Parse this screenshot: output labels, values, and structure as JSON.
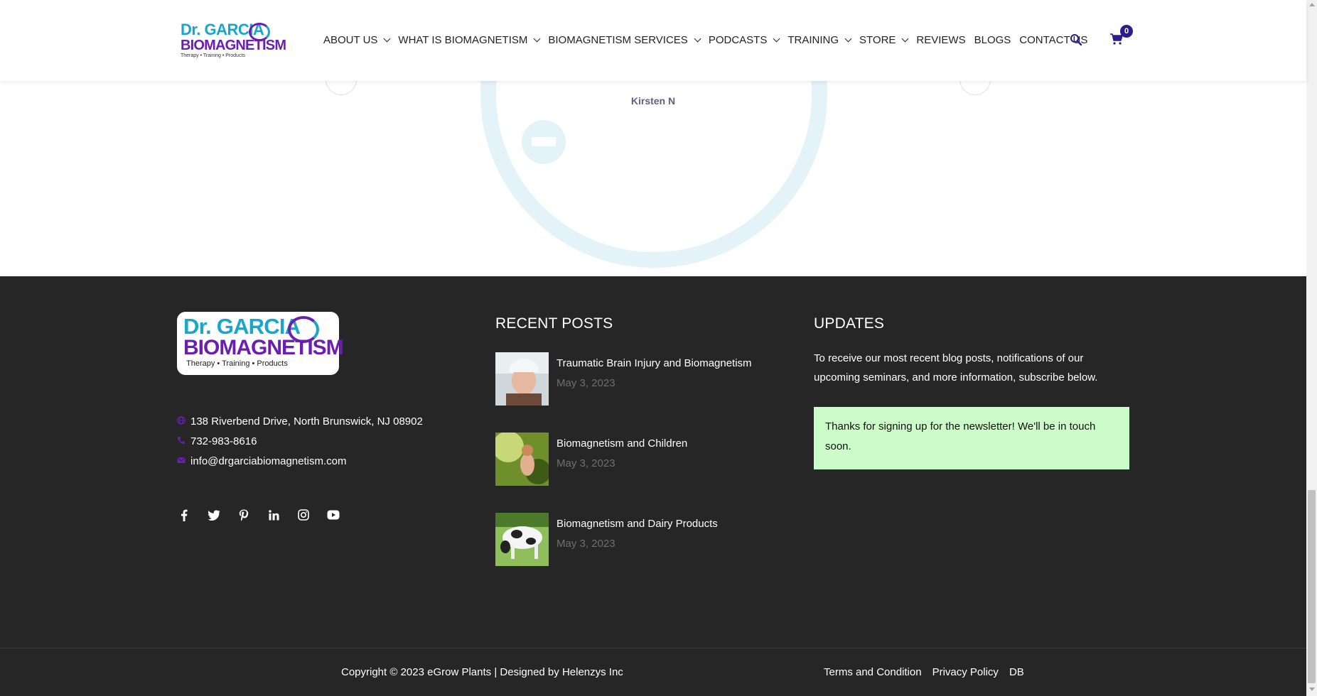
{
  "header": {
    "logo": {
      "line1": "Dr. GARCIA",
      "line2": "BIOMAGNETISM",
      "line3": "Therapy • Training • Products"
    },
    "nav": [
      {
        "label": "ABOUT US",
        "dropdown": true
      },
      {
        "label": "WHAT IS BIOMAGNETISM",
        "dropdown": true
      },
      {
        "label": "BIOMAGNETISM SERVICES",
        "dropdown": true
      },
      {
        "label": "PODCASTS",
        "dropdown": true
      },
      {
        "label": "TRAINING",
        "dropdown": true
      },
      {
        "label": "STORE",
        "dropdown": true
      },
      {
        "label": "REVIEWS",
        "dropdown": false
      },
      {
        "label": "BLOGS",
        "dropdown": false
      },
      {
        "label": "CONTACT US",
        "dropdown": false
      }
    ],
    "cart_count": "0",
    "icons": {
      "search": "search-icon",
      "cart": "cart-icon"
    }
  },
  "testimonial": {
    "reviewer": "Kirsten N"
  },
  "footer": {
    "logo": {
      "line1": "Dr. GARCIA",
      "line2": "BIOMAGNETISM",
      "line3": "Therapy • Training • Products"
    },
    "contact": {
      "address": "138 Riverbend Drive, North Brunswick, NJ 08902",
      "phone": "732-983-8616",
      "email": "info@drgarciabiomagnetism.com"
    },
    "social": [
      "facebook-icon",
      "twitter-icon",
      "pinterest-icon",
      "linkedin-icon",
      "instagram-icon",
      "youtube-icon"
    ],
    "recent_posts": {
      "title": "RECENT POSTS",
      "posts": [
        {
          "title": "Traumatic Brain Injury and Biomagnetism",
          "date": "May 3, 2023"
        },
        {
          "title": "Biomagnetism and Children",
          "date": "May 3, 2023"
        },
        {
          "title": "Biomagnetism and Dairy Products",
          "date": "May 3, 2023"
        }
      ]
    },
    "updates": {
      "title": "UPDATES",
      "text": "To receive our most recent blog posts, notifications of our upcoming seminars, and more information, subscribe below.",
      "success": "Thanks for signing up for the newsletter! We'll be in touch soon."
    }
  },
  "bottom": {
    "copyright": "Copyright © 2023 eGrow Plants | Designed by Helenzys Inc",
    "links": [
      "Terms and Condition",
      "Privacy Policy",
      "DB"
    ]
  },
  "colors": {
    "footer_bg": "#262626",
    "accent_purple": "#6a1fb0",
    "accent_cyan": "#1aa6c9",
    "success_bg": "#ccfcc7",
    "badge": "#2a1e8c"
  }
}
